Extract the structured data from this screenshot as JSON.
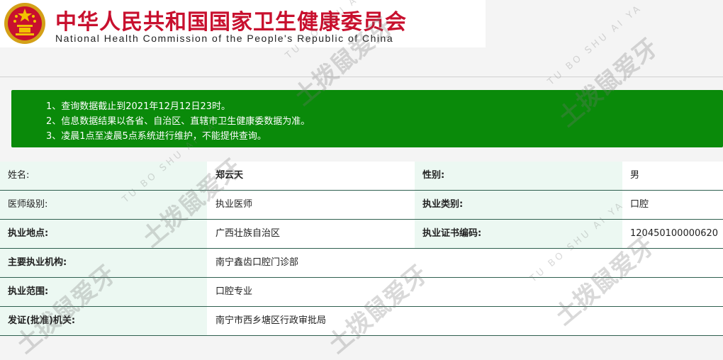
{
  "header": {
    "title_cn": "中华人民共和国国家卫生健康委员会",
    "title_en": "National Health Commission of the People's Republic of China",
    "brand_color": "#c8102e"
  },
  "notice": {
    "color": "#0a8a0a",
    "lines": [
      "1、查询数据截止到2021年12月12日23时。",
      "2、信息数据结果以各省、自治区、直辖市卫生健康委数据为准。",
      "3、凌晨1点至凌晨5点系统进行维护，不能提供查询。"
    ]
  },
  "record": {
    "name_label": "姓名:",
    "name_value": "郑云天",
    "gender_label": "性别:",
    "gender_value": "男",
    "level_label": "医师级别:",
    "level_value": "执业医师",
    "category_label": "执业类别:",
    "category_value": "口腔",
    "location_label": "执业地点:",
    "location_value": "广西壮族自治区",
    "cert_label": "执业证书编码:",
    "cert_value": "120450100000620",
    "institution_label": "主要执业机构:",
    "institution_value": "南宁鑫齿口腔门诊部",
    "scope_label": "执业范围:",
    "scope_value": "口腔专业",
    "issuer_label": "发证(批准)机关:",
    "issuer_value": "南宁市西乡塘区行政审批局"
  },
  "watermark": {
    "text": "土拨鼠爱牙",
    "sub": "TU BO SHU AI YA"
  }
}
